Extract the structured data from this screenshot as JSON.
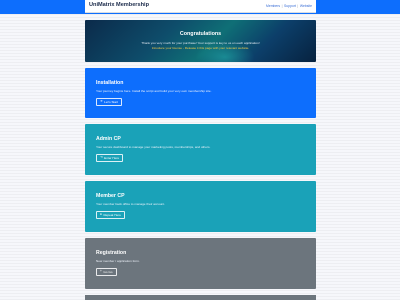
{
  "navbar": {
    "brand": "UniMatrix Membership",
    "links": [
      "Members",
      "Support",
      "Website"
    ]
  },
  "hero": {
    "title": "Congratulations",
    "line1": "Thank you very much for your purchase! Your support is key to us on each application!",
    "line2": "Introduce your license - Release it this page with your relevant website."
  },
  "cards": {
    "installation": {
      "title": "Installation",
      "text": "Your journey begins here. Install the script and build your very own membership site.",
      "button": "Let's Start",
      "icon": "arrow-icon"
    },
    "admin": {
      "title": "Admin CP",
      "text": "Your secure dashboard to manage your marketing posts, memberships, and others.",
      "button": "Enter Here",
      "icon": "login-icon"
    },
    "member": {
      "title": "Member CP",
      "text": "Your member back office to manage their account.",
      "button": "Repeat Here",
      "icon": "user-icon"
    },
    "registration": {
      "title": "Registration",
      "text": "New member / application form.",
      "button": "Go Go",
      "icon": "user-plus-icon"
    }
  },
  "colors": {
    "primary": "#0d6efd",
    "info": "#1aa2b8",
    "secondary": "#6c757d",
    "hero_dark": "#0b2a4a",
    "hero_highlight": "#f2c94c"
  }
}
